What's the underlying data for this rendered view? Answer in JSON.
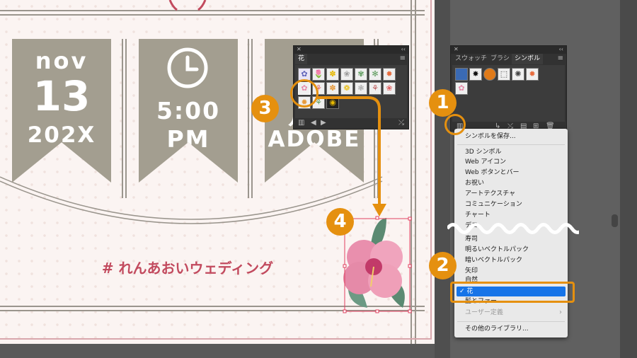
{
  "artboard": {
    "banners": [
      {
        "line1": "nov",
        "line2": "13",
        "line3": "202X"
      },
      {
        "line1": "",
        "line2": "5:00",
        "line3": "PM",
        "icon": "clock-icon"
      },
      {
        "line1": "",
        "line2": "",
        "line3": "ADOBE",
        "partial": "ル"
      }
    ],
    "hashtag": "# れんあおいウェディング",
    "colors": {
      "banner": "#a39e90",
      "accent": "#c24a5e",
      "background": "#fbf4f2"
    }
  },
  "flower_panel": {
    "title": "花",
    "close": "✕",
    "collapse": "‹‹",
    "menu": "≡",
    "nav_prev": "◀",
    "nav_next": "▶",
    "library_icon": "library-icon",
    "break_link_icon": "break-link-icon"
  },
  "symbols_panel": {
    "tabs": [
      "スウォッチ",
      "ブラシ",
      "シンボル"
    ],
    "active_tab": "シンボル",
    "close": "✕",
    "collapse": "‹‹",
    "menu": "≡"
  },
  "library_menu": {
    "items": [
      "シンボルを保存...",
      "3D シンボル",
      "Web アイコン",
      "Web ボタンとバー",
      "お祝い",
      "アートテクスチャ",
      "コミュニケーション",
      "チャート",
      "デコ",
      "寿司",
      "明るいベクトルパック",
      "暗いベクトルパック",
      "矢印",
      "自然",
      "花",
      "髪とファー",
      "ユーザー定義",
      "その他のライブラリ..."
    ],
    "selected": "✓ 花",
    "submenu_arrow": "›",
    "accent": "#1674e8"
  },
  "callouts": [
    "1",
    "2",
    "3",
    "4"
  ],
  "callout_color": "#e5900f"
}
